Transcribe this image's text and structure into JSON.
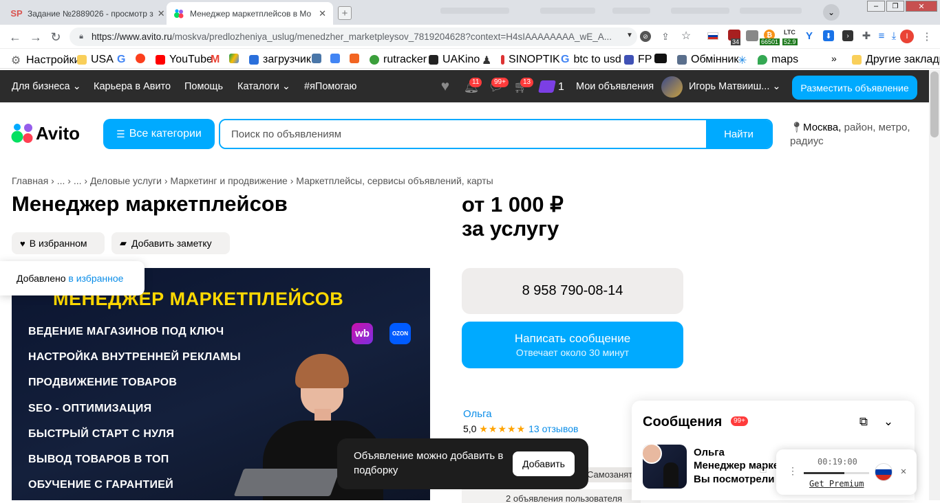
{
  "browser": {
    "tabs": [
      {
        "title": "Задание №2889026 - просмотр з",
        "close": "✕",
        "fav": "SP",
        "fav_color": "#d9534f"
      },
      {
        "title": "Менеджер маркетплейсов в Мо",
        "close": "✕"
      }
    ],
    "url_host": "https://www.avito.ru",
    "url_path": "/moskva/predlozheniya_uslug/menedzher_marketpleysov_7819204628?context=H4sIAAAAAAAA_wE_A...",
    "bookmarks": [
      "Настройки",
      "USA",
      "YouTube",
      "загрузчик",
      "rutracker",
      "UAKino",
      "SINOPTIK",
      "btc to usd",
      "FP",
      "Обмінник",
      "maps"
    ],
    "bookmarks_more": "»",
    "other_bookmarks": "Другие закладки",
    "ext_ltc_label": "LTC",
    "ext_ltc_value": "52.9",
    "ext_btc_value": "66501",
    "ext_badge": "34",
    "profile_letter": "I"
  },
  "avito": {
    "nav": {
      "business": "Для бизнеса",
      "career": "Карьера в Авито",
      "help": "Помощь",
      "catalogs": "Каталоги",
      "ihelp": "#яПомогаю",
      "notif_count": "11",
      "messages_count": "99+",
      "cart_count": "13",
      "promo_count": "1",
      "my_ads": "Мои объявления",
      "user": "Игорь Матвииш...",
      "place_ad": "Разместить объявление"
    },
    "logo": "Avito",
    "all_categories": "Все категории",
    "search_placeholder": "Поиск по объявлениям",
    "find": "Найти",
    "location_city": "Москва,",
    "location_rest": " район, метро, радиус",
    "breadcrumbs": "Главная  ›  ...  ›  ...  ›  Деловые услуги  ›  Маркетинг и продвижение  ›  Маркетплейсы, сервисы объявлений, карты",
    "title": "Менеджер маркетплейсов",
    "price_line1": "от 1 000 ₽",
    "price_line2": "за услугу",
    "favorite_btn": "В избранном",
    "note_btn": "Добавить заметку",
    "tooltip_text": "Добавлено ",
    "tooltip_link": "в избранное",
    "banner": {
      "heading": "МЕНЕДЖЕР МАРКЕТПЛЕЙСОВ",
      "lines": [
        "ВЕДЕНИЕ МАГАЗИНОВ ПОД КЛЮЧ",
        "НАСТРОЙКА ВНУТРЕННЕЙ РЕКЛАМЫ",
        "ПРОДВИЖЕНИЕ ТОВАРОВ",
        "SEO - ОПТИМИЗАЦИЯ",
        "БЫСТРЫЙ СТАРТ С НУЛЯ",
        "ВЫВОД ТОВАРОВ В ТОП",
        "ОБУЧЕНИЕ С ГАРАНТИЕЙ"
      ],
      "wb": "wb",
      "ozon": "OZON"
    },
    "phone": "8 958 790-08-14",
    "write_msg": "Написать сообщение",
    "write_sub": "Отвечает около 30 минут",
    "seller_name": "Ольга",
    "rating_value": "5,0",
    "rating_stars": "★★★★★",
    "reviews": "13 отзывов",
    "self_employed": "Самозанятый",
    "other_ads": "2 объявления пользователя",
    "toast_text": "Объявление можно добавить в подборку",
    "toast_btn": "Добавить"
  },
  "messages_panel": {
    "title": "Сообщения",
    "badge": "99+",
    "chat_name": "Ольга",
    "chat_subject": "Менеджер маркетплейсов",
    "chat_text": "Вы посмотрели его"
  },
  "premium_widget": {
    "time": "00:19:00",
    "link": "Get Premium",
    "progress": 0.62
  }
}
